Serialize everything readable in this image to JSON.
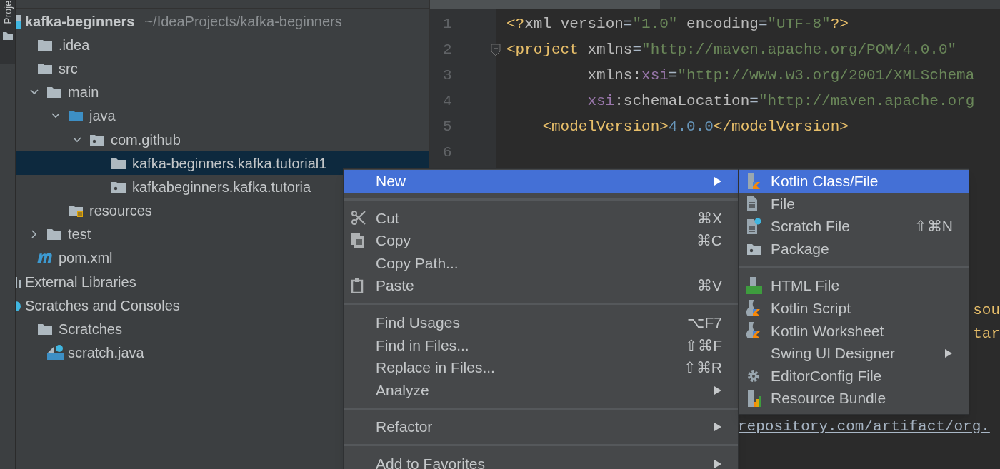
{
  "tool_strip": {
    "label": "Proje"
  },
  "project_tree": {
    "items": [
      {
        "label": "kafka-beginners",
        "path": "~/IdeaProjects/kafka-beginners",
        "kind": "module",
        "selected": false,
        "children": [
          {
            "label": ".idea",
            "kind": "folder",
            "selected": false
          },
          {
            "label": "src",
            "kind": "folder",
            "selected": false,
            "children": [
              {
                "label": "main",
                "kind": "folder",
                "expanded": true,
                "selected": false,
                "children": [
                  {
                    "label": "java",
                    "kind": "source_folder",
                    "expanded": true,
                    "selected": false,
                    "children": [
                      {
                        "label": "com.github",
                        "kind": "package",
                        "expanded": true,
                        "selected": false,
                        "children": [
                          {
                            "label": "kafka-beginners.kafka.tutorial1",
                            "kind": "folder",
                            "selected": true
                          },
                          {
                            "label": "kafkabeginners.kafka.tutoria",
                            "kind": "package",
                            "selected": false
                          }
                        ]
                      }
                    ]
                  },
                  {
                    "label": "resources",
                    "kind": "resources_folder",
                    "selected": false
                  }
                ]
              },
              {
                "label": "test",
                "kind": "folder",
                "expanded": false,
                "selected": false
              }
            ]
          },
          {
            "label": "pom.xml",
            "kind": "maven",
            "selected": false
          }
        ]
      },
      {
        "label": "External Libraries",
        "kind": "libraries",
        "selected": false
      },
      {
        "label": "Scratches and Consoles",
        "kind": "scratches",
        "selected": false,
        "children": [
          {
            "label": "Scratches",
            "kind": "folder",
            "selected": false,
            "children": [
              {
                "label": "scratch.java",
                "kind": "java_scratch",
                "selected": false
              }
            ]
          }
        ]
      }
    ]
  },
  "editor": {
    "lines": [
      {
        "number": "1",
        "tokens": [
          {
            "kind": "tag",
            "text": "<?"
          },
          {
            "kind": "attr",
            "text": "xml version"
          },
          {
            "kind": "punct",
            "text": "="
          },
          {
            "kind": "value",
            "text": "\"1.0\""
          },
          {
            "kind": "attr",
            "text": " encoding"
          },
          {
            "kind": "punct",
            "text": "="
          },
          {
            "kind": "value",
            "text": "\"UTF-8\""
          },
          {
            "kind": "tag",
            "text": "?>"
          }
        ]
      },
      {
        "number": "2",
        "fold": true,
        "tokens": [
          {
            "kind": "tag",
            "text": "<project"
          },
          {
            "kind": "attr",
            "text": " xmlns"
          },
          {
            "kind": "punct",
            "text": "="
          },
          {
            "kind": "value",
            "text": "\"http://maven.apache.org/POM/4.0.0\""
          }
        ]
      },
      {
        "number": "3",
        "tokens": [
          {
            "kind": "attr",
            "text": "         xmlns:"
          },
          {
            "kind": "ns",
            "text": "xsi"
          },
          {
            "kind": "punct",
            "text": "="
          },
          {
            "kind": "value",
            "text": "\"http://www.w3.org/2001/XMLSchema"
          }
        ]
      },
      {
        "number": "4",
        "tokens": [
          {
            "kind": "ns",
            "text": "         xsi"
          },
          {
            "kind": "attr",
            "text": ":schemaLocation"
          },
          {
            "kind": "punct",
            "text": "="
          },
          {
            "kind": "value",
            "text": "\"http://maven.apache.org"
          }
        ]
      },
      {
        "number": "5",
        "tokens": [
          {
            "kind": "tag",
            "text": "    <modelVersion>"
          },
          {
            "kind": "number",
            "text": "4.0.0"
          },
          {
            "kind": "tag",
            "text": "</modelVersion>"
          }
        ]
      },
      {
        "number": "6"
      }
    ],
    "fragments": [
      {
        "text": "sou"
      },
      {
        "text": "tar"
      }
    ],
    "link": "repository.com/artifact/org."
  },
  "context_menu": {
    "groups": [
      [
        {
          "label": "New",
          "kind": "plain",
          "submenu": true,
          "selected": true
        }
      ],
      [
        {
          "label": "Cut",
          "kind": "scissors",
          "shortcut": "⌘X",
          "submenu": false,
          "selected": false
        },
        {
          "label": "Copy",
          "kind": "copy",
          "shortcut": "⌘C",
          "submenu": false,
          "selected": false
        },
        {
          "label": "Copy Path...",
          "kind": "plain",
          "submenu": false,
          "selected": false
        },
        {
          "label": "Paste",
          "kind": "clipboard",
          "shortcut": "⌘V",
          "submenu": false,
          "selected": false
        }
      ],
      [
        {
          "label": "Find Usages",
          "kind": "plain",
          "shortcut": "⌥F7",
          "submenu": false,
          "selected": false
        },
        {
          "label": "Find in Files...",
          "kind": "plain",
          "shortcut": "⇧⌘F",
          "submenu": false,
          "selected": false
        },
        {
          "label": "Replace in Files...",
          "kind": "plain",
          "shortcut": "⇧⌘R",
          "submenu": false,
          "selected": false
        },
        {
          "label": "Analyze",
          "kind": "plain",
          "submenu": true,
          "selected": false
        }
      ],
      [
        {
          "label": "Refactor",
          "kind": "plain",
          "submenu": true,
          "selected": false
        }
      ],
      [
        {
          "label": "Add to Favorites",
          "kind": "plain",
          "submenu": true,
          "selected": false
        }
      ]
    ]
  },
  "new_submenu": {
    "groups": [
      [
        {
          "label": "Kotlin Class/File",
          "kind": "kotlin_file",
          "submenu": false,
          "selected": true
        },
        {
          "label": "File",
          "kind": "file",
          "submenu": false,
          "selected": false
        },
        {
          "label": "Scratch File",
          "kind": "scratch_file",
          "shortcut": "⇧⌘N",
          "submenu": false,
          "selected": false
        },
        {
          "label": "Package",
          "kind": "package",
          "submenu": false,
          "selected": false
        }
      ],
      [
        {
          "label": "HTML File",
          "kind": "html_file",
          "submenu": false,
          "selected": false
        },
        {
          "label": "Kotlin Script",
          "kind": "kotlin_script",
          "submenu": false,
          "selected": false
        },
        {
          "label": "Kotlin Worksheet",
          "kind": "kotlin_script",
          "submenu": false,
          "selected": false
        },
        {
          "label": "Swing UI Designer",
          "kind": "plain",
          "submenu": true,
          "selected": false
        },
        {
          "label": "EditorConfig File",
          "kind": "gear",
          "submenu": false,
          "selected": false
        },
        {
          "label": "Resource Bundle",
          "kind": "bundle",
          "submenu": false,
          "selected": false
        }
      ]
    ]
  }
}
